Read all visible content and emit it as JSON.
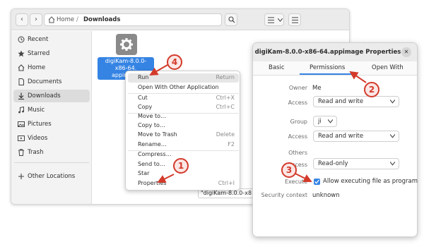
{
  "file_manager": {
    "path": {
      "home": "Home",
      "current": "Downloads"
    },
    "sidebar": [
      {
        "label": "Recent",
        "icon": "clock-icon"
      },
      {
        "label": "Starred",
        "icon": "star-icon"
      },
      {
        "label": "Home",
        "icon": "home-icon"
      },
      {
        "label": "Documents",
        "icon": "document-icon"
      },
      {
        "label": "Downloads",
        "icon": "download-icon",
        "active": true
      },
      {
        "label": "Music",
        "icon": "music-icon"
      },
      {
        "label": "Pictures",
        "icon": "picture-icon"
      },
      {
        "label": "Videos",
        "icon": "video-icon"
      },
      {
        "label": "Trash",
        "icon": "trash-icon"
      },
      {
        "label": "Other Locations",
        "icon": "plus-icon"
      }
    ],
    "file": {
      "name_line1": "digiKam-8.0.0-",
      "name_line2": "x86-64.",
      "name_line3": "appimage"
    },
    "status_text": "\"digiKam-8.0.0-x8"
  },
  "context_menu": {
    "items": [
      {
        "label": "Run",
        "shortcut": "Return"
      },
      {
        "label": "Open With Other Application",
        "shortcut": ""
      },
      {
        "label": "Cut",
        "shortcut": "Ctrl+X"
      },
      {
        "label": "Copy",
        "shortcut": "Ctrl+C"
      },
      {
        "label": "Move to…",
        "shortcut": ""
      },
      {
        "label": "Copy to…",
        "shortcut": ""
      },
      {
        "label": "Move to Trash",
        "shortcut": "Delete"
      },
      {
        "label": "Rename…",
        "shortcut": "F2"
      },
      {
        "label": "Compress…",
        "shortcut": ""
      },
      {
        "label": "Send to…",
        "shortcut": ""
      },
      {
        "label": "Star",
        "shortcut": ""
      },
      {
        "label": "Properties",
        "shortcut": "Ctrl+I"
      }
    ]
  },
  "dialog": {
    "title": "digiKam-8.0.0-x86-64.appimage Properties",
    "tabs": [
      "Basic",
      "Permissions",
      "Open With"
    ],
    "owner_label": "Owner",
    "owner_value": "Me",
    "owner_access_label": "Access",
    "owner_access_value": "Read and write",
    "group_label": "Group",
    "group_value": "ji",
    "group_access_label": "Access",
    "group_access_value": "Read and write",
    "others_label": "Others",
    "others_access_label": "Access",
    "others_access_value": "Read-only",
    "execute_label": "Execute",
    "execute_checkbox_label": "Allow executing file as program",
    "security_label": "Security context",
    "security_value": "unknown"
  },
  "annotations": {
    "b1": "1",
    "b2": "2",
    "b3": "3",
    "b4": "4",
    "color": "#d33a2a"
  },
  "colors": {
    "accent": "#3584e4"
  }
}
